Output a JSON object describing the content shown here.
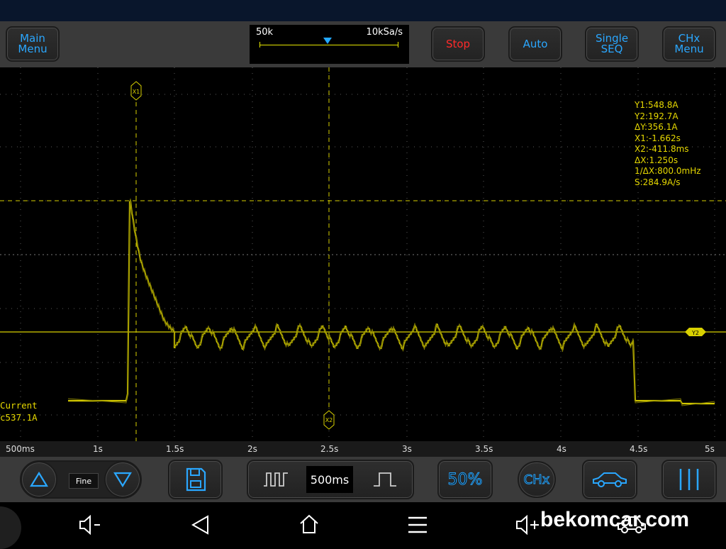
{
  "header": {
    "main_menu": "Main\nMenu",
    "stop": "Stop",
    "auto": "Auto",
    "single_seq": "Single\nSEQ",
    "chx_menu": "CHx\nMenu"
  },
  "timebase": {
    "points": "50k",
    "sample_rate": "10kSa/s"
  },
  "cursors": {
    "x1": "X1",
    "x2": "X2",
    "y2": "Y2"
  },
  "measurements": [
    "Y1:548.8A",
    "Y2:192.7A",
    "ΔY:356.1A",
    "X1:-1.662s",
    "X2:-411.8ms",
    "ΔX:1.250s",
    "1/ΔX:800.0mHz",
    "S:284.9A/s"
  ],
  "channel": {
    "name": "Current",
    "value": "c537.1A"
  },
  "x_axis_labels": [
    "500ms",
    "1s",
    "1.5s",
    "2s",
    "2.5s",
    "3s",
    "3.5s",
    "4s",
    "4.5s",
    "5s"
  ],
  "toolbar": {
    "fine": "Fine",
    "timebase_value": "500ms",
    "trigger_level": "50%",
    "chx": "CHx"
  },
  "watermark": "bekomcar.com",
  "colors": {
    "trace": "#d8d000",
    "accent": "#2aa7ff",
    "stop": "#ff2a2a",
    "panel": "#3a3a3a"
  }
}
